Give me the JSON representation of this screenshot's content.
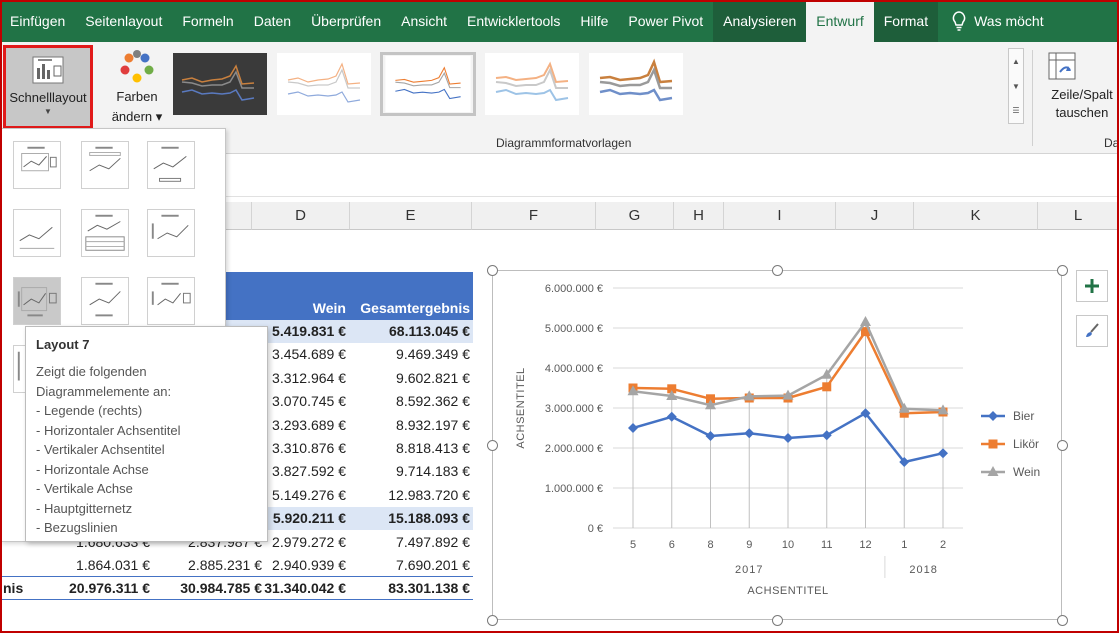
{
  "ribbon": {
    "tabs": [
      "Einfügen",
      "Seitenlayout",
      "Formeln",
      "Daten",
      "Überprüfen",
      "Ansicht",
      "Entwicklertools",
      "Hilfe",
      "Power Pivot",
      "Analysieren",
      "Entwurf",
      "Format"
    ],
    "tell_me": "Was möcht",
    "schnelllayout": "Schnelllayout",
    "farben_line1": "Farben",
    "farben_line2": "ändern",
    "gallery_group": "Diagrammformatvorlagen",
    "zeile_line1": "Zeile/Spalt",
    "zeile_line2": "tauschen",
    "next_group_fragment": "Da",
    "colors": {
      "excel_green": "#217346",
      "accent": "#4472c4"
    }
  },
  "columns": [
    "D",
    "E",
    "F",
    "G",
    "H",
    "I",
    "J",
    "K",
    "L"
  ],
  "table": {
    "header": {
      "wein": "Wein",
      "gesamt": "Gesamtergebnis"
    },
    "rows": [
      {
        "c": "",
        "wein": "5.419.831 €",
        "gesamt": "68.113.045 €",
        "bold": true
      },
      {
        "c": "",
        "wein": "3.454.689 €",
        "gesamt": "9.469.349 €"
      },
      {
        "c": "",
        "wein": "3.312.964 €",
        "gesamt": "9.602.821 €"
      },
      {
        "c": "",
        "wein": "3.070.745 €",
        "gesamt": "8.592.362 €"
      },
      {
        "c": "",
        "wein": "3.293.689 €",
        "gesamt": "8.932.197 €"
      },
      {
        "c": "",
        "wein": "3.310.876 €",
        "gesamt": "8.818.413 €"
      },
      {
        "c": "",
        "wein": "3.827.592 €",
        "gesamt": "9.714.183 €"
      },
      {
        "c": "",
        "wein": "5.149.276 €",
        "gesamt": "12.983.720 €"
      },
      {
        "c": "",
        "wein": "5.920.211 €",
        "gesamt": "15.188.093 €",
        "bold": true
      },
      {
        "c": "2.837.987 €",
        "wein": "2.979.272 €",
        "gesamt": "7.497.892 €",
        "b": "1.680.633 €"
      },
      {
        "c": "2.885.231 €",
        "wein": "2.940.939 €",
        "gesamt": "7.690.201 €",
        "b": "1.864.031 €"
      }
    ],
    "total": {
      "label": "nis",
      "b": "20.976.311 €",
      "c": "30.984.785 €",
      "wein": "31.340.042 €",
      "gesamt": "83.301.138 €"
    }
  },
  "tooltip": {
    "title": "Layout 7",
    "lines": [
      "Zeigt die folgenden",
      "Diagrammelemente an:",
      "- Legende (rechts)",
      "- Horizontaler Achsentitel",
      "- Vertikaler Achsentitel",
      "- Horizontale Achse",
      "- Vertikale Achse",
      "- Hauptgitternetz",
      "- Bezugslinien"
    ]
  },
  "chart_data": {
    "type": "line",
    "x": [
      "5",
      "6",
      "8",
      "9",
      "10",
      "11",
      "12",
      "1",
      "2"
    ],
    "x_groups": [
      {
        "label": "2017",
        "from": 0,
        "to": 6
      },
      {
        "label": "2018",
        "from": 7,
        "to": 8
      }
    ],
    "y_ticks": [
      "0 €",
      "1.000.000 €",
      "2.000.000 €",
      "3.000.000 €",
      "4.000.000 €",
      "5.000.000 €",
      "6.000.000 €"
    ],
    "ylim": [
      0,
      6000000
    ],
    "xlabel": "ACHSENTITEL",
    "ylabel": "ACHSENTITEL",
    "legend_position": "right",
    "grid": true,
    "drop_lines": true,
    "series": [
      {
        "name": "Bier",
        "color": "#4472c4",
        "marker": "diamond",
        "values": [
          2500000,
          2780000,
          2300000,
          2370000,
          2250000,
          2320000,
          2870000,
          1650000,
          1870000
        ]
      },
      {
        "name": "Likör",
        "color": "#ed7d31",
        "marker": "square",
        "values": [
          3500000,
          3480000,
          3230000,
          3250000,
          3250000,
          3530000,
          4910000,
          2870000,
          2900000
        ]
      },
      {
        "name": "Wein",
        "color": "#a5a5a5",
        "marker": "triangle",
        "values": [
          3420000,
          3300000,
          3070000,
          3290000,
          3310000,
          3830000,
          5150000,
          2980000,
          2940000
        ]
      }
    ]
  }
}
